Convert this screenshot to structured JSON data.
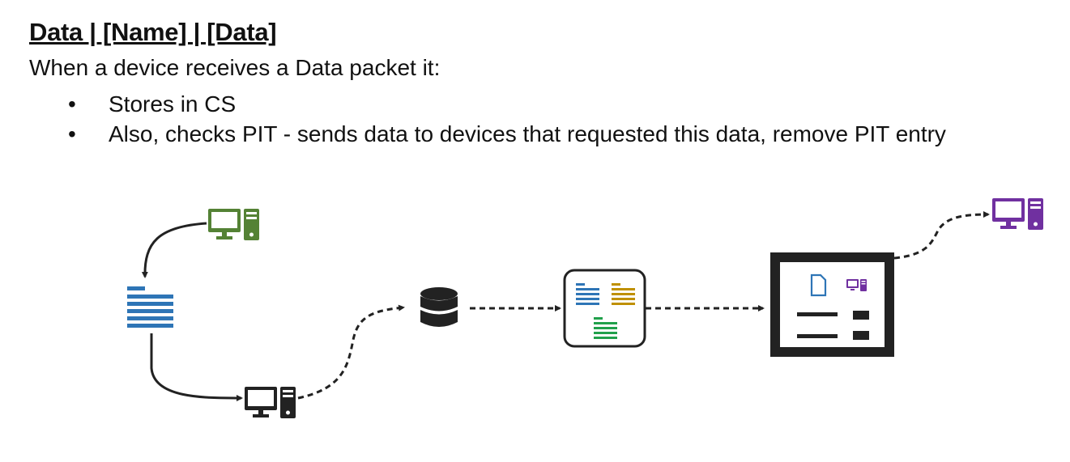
{
  "heading": "Data | [Name] | [Data]",
  "intro": "When a device receives a Data packet it:",
  "bullets": [
    "Stores in CS",
    "Also, checks PIT - sends data to devices that requested this data, remove PIT entry"
  ],
  "bullet_char": "•",
  "diagram": {
    "icons": {
      "source_computer": "desktop-computer-icon",
      "data_packet": "document-lines-icon",
      "router_computer": "desktop-computer-icon",
      "content_store": "database-icon",
      "pit_table": "table-panel-icon",
      "forwarding_panel": "device-panel-icon",
      "destination_computer": "desktop-computer-icon"
    },
    "colors": {
      "green": "#548235",
      "blue": "#2e75b6",
      "dark": "#222222",
      "gold": "#bf9000",
      "emerald": "#21a04b",
      "purple": "#7030a0"
    }
  }
}
